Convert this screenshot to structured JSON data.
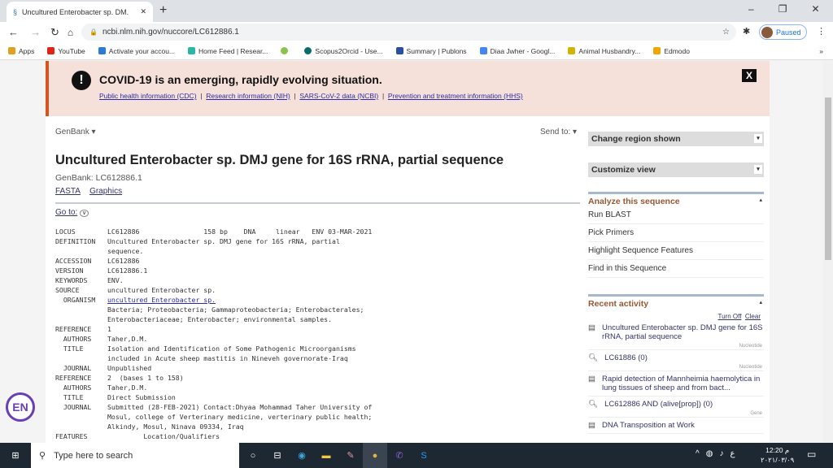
{
  "browser": {
    "tab_title": "Uncultured Enterobacter sp. DM.",
    "url": "ncbi.nlm.nih.gov/nuccore/LC612886.1",
    "profile_label": "Paused",
    "bookmarks": [
      {
        "label": "Apps",
        "color": "#e0a020"
      },
      {
        "label": "YouTube",
        "color": "#e62117"
      },
      {
        "label": "Activate your accou...",
        "color": "#2a7ad8"
      },
      {
        "label": "Home Feed | Resear...",
        "color": "#2bb7a5"
      },
      {
        "label": "",
        "color": "#8bc34a"
      },
      {
        "label": "Scopus2Orcid - Use...",
        "color": "#0a6b6b"
      },
      {
        "label": "Summary | Publons",
        "color": "#2a4f9e"
      },
      {
        "label": "Diaa Jwher - Googl...",
        "color": "#4285f4"
      },
      {
        "label": "Animal Husbandry...",
        "color": "#d4b400"
      },
      {
        "label": "Edmodo",
        "color": "#f0a800"
      }
    ]
  },
  "banner": {
    "title": "COVID-19 is an emerging, rapidly evolving situation.",
    "links": [
      "Public health information (CDC)",
      "Research information (NIH)",
      "SARS-CoV-2 data (NCBI)",
      "Prevention and treatment information (HHS)"
    ],
    "sep": "|",
    "close": "X"
  },
  "main": {
    "format": "GenBank ▾",
    "send_to": "Send to: ▾",
    "title": "Uncultured Enterobacter sp. DMJ gene for 16S rRNA, partial sequence",
    "accession_line": "GenBank: LC612886.1",
    "fasta": "FASTA",
    "graphics": "Graphics",
    "goto": "Go to:",
    "record": [
      [
        "LOCUS",
        "LC612886                158 bp    DNA     linear   ENV 03-MAR-2021"
      ],
      [
        "DEFINITION",
        "Uncultured Enterobacter sp. DMJ gene for 16S rRNA, partial"
      ],
      [
        "",
        "sequence."
      ],
      [
        "ACCESSION",
        "LC612886"
      ],
      [
        "VERSION",
        "LC612886.1"
      ],
      [
        "KEYWORDS",
        "ENV."
      ],
      [
        "SOURCE",
        "uncultured Enterobacter sp."
      ],
      [
        "  ORGANISM",
        "uncultured Enterobacter sp."
      ],
      [
        "",
        "Bacteria; Proteobacteria; Gammaproteobacteria; Enterobacterales;"
      ],
      [
        "",
        "Enterobacteriaceae; Enterobacter; environmental samples."
      ],
      [
        "REFERENCE",
        "1"
      ],
      [
        "  AUTHORS",
        "Taher,D.M."
      ],
      [
        "  TITLE",
        "Isolation and Identification of Some Pathogenic Microorganisms"
      ],
      [
        "",
        "included in Acute sheep mastitis in Nineveh governorate-Iraq"
      ],
      [
        "  JOURNAL",
        "Unpublished"
      ],
      [
        "REFERENCE",
        "2  (bases 1 to 158)"
      ],
      [
        "  AUTHORS",
        "Taher,D.M."
      ],
      [
        "  TITLE",
        "Direct Submission"
      ],
      [
        "  JOURNAL",
        "Submitted (28-FEB-2021) Contact:Dhyaa Mohammad Taher University of"
      ],
      [
        "",
        "Mosul, college of Verterinary medicine, verterinary public health;"
      ],
      [
        "",
        "Alkindy, Mosul, Ninava 09334, Iraq"
      ],
      [
        "FEATURES",
        "         Location/Qualifiers"
      ]
    ]
  },
  "sidebar": {
    "change_region": "Change region shown",
    "customize": "Customize view",
    "analyze_title": "Analyze this sequence",
    "analyze_links": [
      "Run BLAST",
      "Pick Primers",
      "Highlight Sequence Features",
      "Find in this Sequence"
    ],
    "recent_title": "Recent activity",
    "turn_off": "Turn Off",
    "clear": "Clear",
    "recent": [
      {
        "icon": "document",
        "text": "Uncultured Enterobacter sp. DMJ gene for 16S rRNA, partial sequence",
        "db": "Nucleotide"
      },
      {
        "icon": "search",
        "text": "LC61886 (0)",
        "db": "Nucleotide"
      },
      {
        "icon": "document",
        "text": "Rapid detection of Mannheimia haemolytica in lung tissues of sheep and from bact...",
        "db": ""
      },
      {
        "icon": "search",
        "text": "LC612886 AND (alive[prop]) (0)",
        "db": "Gene"
      },
      {
        "icon": "document",
        "text": "DNA Transposition at Work",
        "db": ""
      }
    ]
  },
  "overlay": {
    "lang_badge": "EN"
  },
  "taskbar": {
    "search_placeholder": "Type here to search",
    "time": "12:20 م",
    "date": "٢٠٢١/٠٣/٠٩",
    "lang": "ع"
  }
}
